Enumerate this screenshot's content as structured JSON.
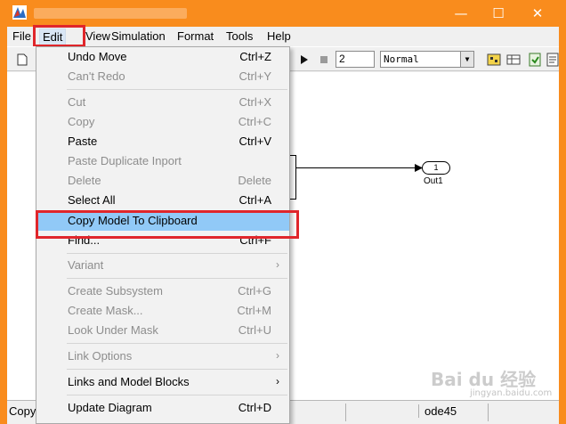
{
  "window": {
    "controls": {
      "minimize": "—",
      "maximize": "☐",
      "close": "✕"
    },
    "accent_color": "#f98c1d"
  },
  "menubar": {
    "items": [
      "File",
      "Edit",
      "View",
      "Simulation",
      "Format",
      "Tools",
      "Help"
    ],
    "active": "Edit",
    "highlight_color": "#e0262b"
  },
  "toolbar": {
    "stop_time": "2",
    "sim_mode": "Normal"
  },
  "model": {
    "outport_number": "1",
    "outport_label": "Out1"
  },
  "edit_menu": {
    "items": [
      {
        "label": "Undo Move",
        "shortcut": "Ctrl+Z",
        "enabled": true
      },
      {
        "label": "Can't Redo",
        "shortcut": "Ctrl+Y",
        "enabled": false
      },
      {
        "label": "Cut",
        "shortcut": "Ctrl+X",
        "enabled": false
      },
      {
        "label": "Copy",
        "shortcut": "Ctrl+C",
        "enabled": false
      },
      {
        "label": "Paste",
        "shortcut": "Ctrl+V",
        "enabled": true
      },
      {
        "label": "Paste Duplicate Inport",
        "shortcut": "",
        "enabled": false
      },
      {
        "label": "Delete",
        "shortcut": "Delete",
        "enabled": false
      },
      {
        "label": "Select All",
        "shortcut": "Ctrl+A",
        "enabled": true
      },
      {
        "label": "Copy Model To Clipboard",
        "shortcut": "",
        "enabled": true,
        "selected": true
      },
      {
        "label": "Find...",
        "shortcut": "Ctrl+F",
        "enabled": true
      },
      {
        "label": "Variant",
        "shortcut": "",
        "enabled": false,
        "submenu": true
      },
      {
        "label": "Create Subsystem",
        "shortcut": "Ctrl+G",
        "enabled": false
      },
      {
        "label": "Create Mask...",
        "shortcut": "Ctrl+M",
        "enabled": false
      },
      {
        "label": "Look Under Mask",
        "shortcut": "Ctrl+U",
        "enabled": false
      },
      {
        "label": "Link Options",
        "shortcut": "",
        "enabled": false,
        "submenu": true
      },
      {
        "label": "Links and Model Blocks",
        "shortcut": "",
        "enabled": true,
        "submenu": true
      },
      {
        "label": "Update Diagram",
        "shortcut": "Ctrl+D",
        "enabled": true
      }
    ],
    "submenu_arrow": "›",
    "selected_color": "#91c9f7"
  },
  "statusbar": {
    "left_text": "Copy",
    "solver": "ode45"
  },
  "watermark": {
    "text": "Bai du 经验",
    "sub": "jingyan.baidu.com"
  }
}
